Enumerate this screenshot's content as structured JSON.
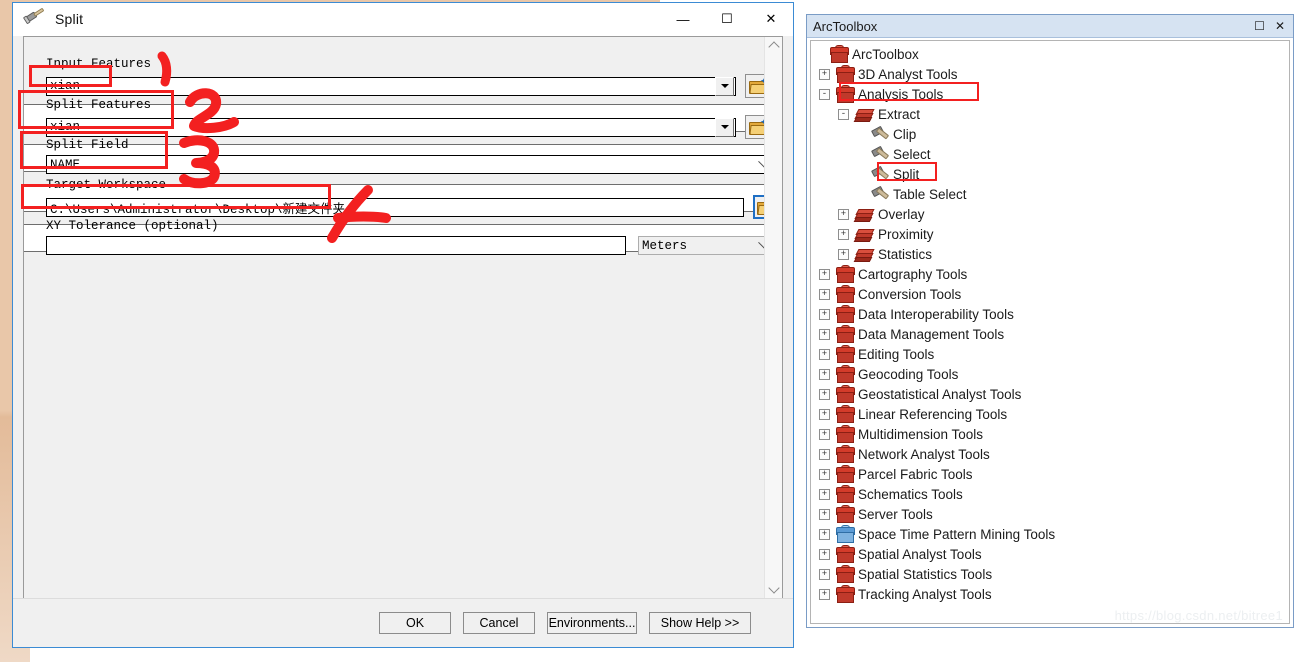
{
  "dialog": {
    "title": "Split",
    "title_icon": "hammer-icon",
    "window_controls": {
      "minimize": "—",
      "maximize": "☐",
      "close": "✕"
    },
    "fields": [
      {
        "label": "Input Features",
        "value": "xian",
        "control": "combo-classic",
        "browse": "open-folder-icon"
      },
      {
        "label": "Split Features",
        "value": "xian",
        "control": "combo-classic",
        "browse": "open-folder-icon"
      },
      {
        "label": "Split Field",
        "value": "NAME",
        "control": "combo-flat",
        "browse": null
      },
      {
        "label": "Target Workspace",
        "value": "C:\\Users\\Administrator\\Desktop\\新建文件夹",
        "control": "textbox",
        "browse": "open-folder-icon"
      },
      {
        "label": "XY Tolerance (optional)",
        "value": "",
        "control": "textbox-unit",
        "unit": "Meters"
      }
    ],
    "buttons": {
      "ok": "OK",
      "cancel": "Cancel",
      "environments": "Environments...",
      "show_help": "Show Help >>"
    },
    "scrollbar": {
      "up_icon": "chevron-up-icon",
      "down_icon": "chevron-down-icon"
    }
  },
  "annotations": {
    "color": "#f32020",
    "marks": [
      {
        "label": "1",
        "target": "Input Features"
      },
      {
        "label": "2",
        "target": "Split Features"
      },
      {
        "label": "3",
        "target": "Split Field"
      },
      {
        "label": "4",
        "target": "Target Workspace"
      }
    ]
  },
  "arctoolbox": {
    "title": "ArcToolbox",
    "controls": {
      "restore": "☐",
      "close": "✕"
    },
    "tree": [
      {
        "label": "ArcToolbox",
        "depth": 0,
        "expander": "",
        "icon": "root-toolbox-icon"
      },
      {
        "label": "3D Analyst Tools",
        "depth": 0,
        "expander": "+",
        "icon": "toolbox-icon"
      },
      {
        "label": "Analysis Tools",
        "depth": 0,
        "expander": "-",
        "icon": "toolbox-icon",
        "highlighted": true
      },
      {
        "label": "Extract",
        "depth": 1,
        "expander": "-",
        "icon": "toolset-icon"
      },
      {
        "label": "Clip",
        "depth": 2,
        "expander": "",
        "icon": "hammer-icon"
      },
      {
        "label": "Select",
        "depth": 2,
        "expander": "",
        "icon": "hammer-icon"
      },
      {
        "label": "Split",
        "depth": 2,
        "expander": "",
        "icon": "hammer-icon",
        "highlighted": true
      },
      {
        "label": "Table Select",
        "depth": 2,
        "expander": "",
        "icon": "hammer-icon"
      },
      {
        "label": "Overlay",
        "depth": 1,
        "expander": "+",
        "icon": "toolset-icon"
      },
      {
        "label": "Proximity",
        "depth": 1,
        "expander": "+",
        "icon": "toolset-icon"
      },
      {
        "label": "Statistics",
        "depth": 1,
        "expander": "+",
        "icon": "toolset-icon"
      },
      {
        "label": "Cartography Tools",
        "depth": 0,
        "expander": "+",
        "icon": "toolbox-icon"
      },
      {
        "label": "Conversion Tools",
        "depth": 0,
        "expander": "+",
        "icon": "toolbox-icon"
      },
      {
        "label": "Data Interoperability Tools",
        "depth": 0,
        "expander": "+",
        "icon": "toolbox-icon"
      },
      {
        "label": "Data Management Tools",
        "depth": 0,
        "expander": "+",
        "icon": "toolbox-icon"
      },
      {
        "label": "Editing Tools",
        "depth": 0,
        "expander": "+",
        "icon": "toolbox-icon"
      },
      {
        "label": "Geocoding Tools",
        "depth": 0,
        "expander": "+",
        "icon": "toolbox-icon"
      },
      {
        "label": "Geostatistical Analyst Tools",
        "depth": 0,
        "expander": "+",
        "icon": "toolbox-icon"
      },
      {
        "label": "Linear Referencing Tools",
        "depth": 0,
        "expander": "+",
        "icon": "toolbox-icon"
      },
      {
        "label": "Multidimension Tools",
        "depth": 0,
        "expander": "+",
        "icon": "toolbox-icon"
      },
      {
        "label": "Network Analyst Tools",
        "depth": 0,
        "expander": "+",
        "icon": "toolbox-icon"
      },
      {
        "label": "Parcel Fabric Tools",
        "depth": 0,
        "expander": "+",
        "icon": "toolbox-icon"
      },
      {
        "label": "Schematics Tools",
        "depth": 0,
        "expander": "+",
        "icon": "toolbox-icon"
      },
      {
        "label": "Server Tools",
        "depth": 0,
        "expander": "+",
        "icon": "toolbox-icon"
      },
      {
        "label": "Space Time Pattern Mining Tools",
        "depth": 0,
        "expander": "+",
        "icon": "toolbox-icon-blue"
      },
      {
        "label": "Spatial Analyst Tools",
        "depth": 0,
        "expander": "+",
        "icon": "toolbox-icon"
      },
      {
        "label": "Spatial Statistics Tools",
        "depth": 0,
        "expander": "+",
        "icon": "toolbox-icon"
      },
      {
        "label": "Tracking Analyst Tools",
        "depth": 0,
        "expander": "+",
        "icon": "toolbox-icon"
      }
    ]
  },
  "watermark": "https://blog.csdn.net/bitree1"
}
